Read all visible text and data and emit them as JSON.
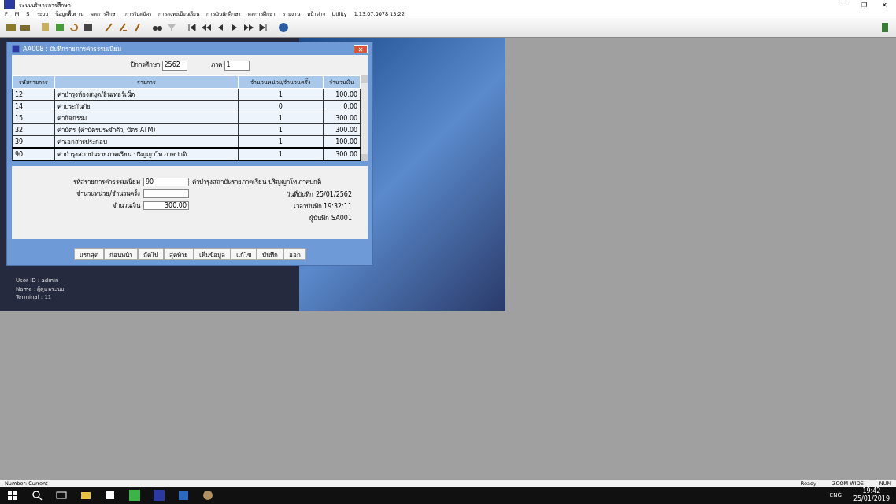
{
  "window": {
    "title": "ระบบบริหารการศึกษา",
    "controls": [
      "—",
      "❐",
      "✕"
    ]
  },
  "menu": [
    "F",
    "M",
    "S",
    "ระบบ",
    "ข้อมูลพื้นฐาน",
    "ผลการศึกษา",
    "การรับสมัคร",
    "การลงทะเบียนเรียน",
    "การเงินนักศึกษา",
    "ผลการศึกษา",
    "รายงาน",
    "หน้าต่าง",
    "Utility",
    "1.13.07.0078 15:22"
  ],
  "dialog": {
    "title": "AA008 : บันทึกรายการค่าธรรมเนียม",
    "filters": [
      {
        "label": "ปีการศึกษา",
        "value": "2562"
      },
      {
        "label": "ภาค",
        "value": "1"
      }
    ],
    "table": {
      "columns": [
        "รหัสรายการ",
        "รายการ",
        "จำนวนหน่วย/จำนวนครั้ง",
        "จำนวนเงิน"
      ],
      "rows": [
        {
          "cells": [
            "12",
            "ค่าบำรุงห้องสมุด/อินเทอร์เน็ต",
            "1",
            "100.00"
          ],
          "selected": false
        },
        {
          "cells": [
            "14",
            "ค่าประกันภัย",
            "0",
            "0.00"
          ],
          "selected": false
        },
        {
          "cells": [
            "15",
            "ค่ากิจกรรม",
            "1",
            "300.00"
          ],
          "selected": false
        },
        {
          "cells": [
            "32",
            "ค่าบัตร (ค่าบัตรประจำตัว, บัตร ATM)",
            "1",
            "300.00"
          ],
          "selected": false
        },
        {
          "cells": [
            "39",
            "ค่าเอกสารประกอบ",
            "1",
            "100.00"
          ],
          "selected": false
        },
        {
          "cells": [
            "90",
            "ค่าบำรุงสถาบันรายภาคเรียน ปริญญาโท ภาคปกติ",
            "1",
            "300.00"
          ],
          "selected": true
        }
      ]
    },
    "form": [
      {
        "label": "รหัสรายการค่าธรรมเนียม",
        "value": "90",
        "note": "ค่าบำรุงสถาบันรายภาคเรียน ปริญญาโท ภาคปกติ"
      },
      {
        "label": "จำนวนหน่วย/จำนวนครั้ง"
      },
      {
        "label": "จำนวนเงิน",
        "value": "300.00"
      }
    ],
    "info": [
      "วันที่บันทึก 25/01/2562",
      "เวลาบันทึก 19:32:11",
      "ผู้บันทึก SA001"
    ],
    "buttons": [
      "แรกสุด",
      "ก่อนหน้า",
      "ถัดไป",
      "สุดท้าย",
      "เพิ่มข้อมูล",
      "แก้ไข",
      "บันทึก",
      "ออก"
    ]
  },
  "user_info": [
    "User ID : admin",
    "Name : ผู้ดูแลระบบ",
    "Terminal : 11"
  ],
  "status_bar": {
    "left": "Number: Current",
    "right": [
      "Ready",
      "ZOOM WIDE",
      "NUM"
    ]
  },
  "taskbar": {
    "clock": "19:42",
    "date": "25/01/2019",
    "lang": "ENG"
  }
}
